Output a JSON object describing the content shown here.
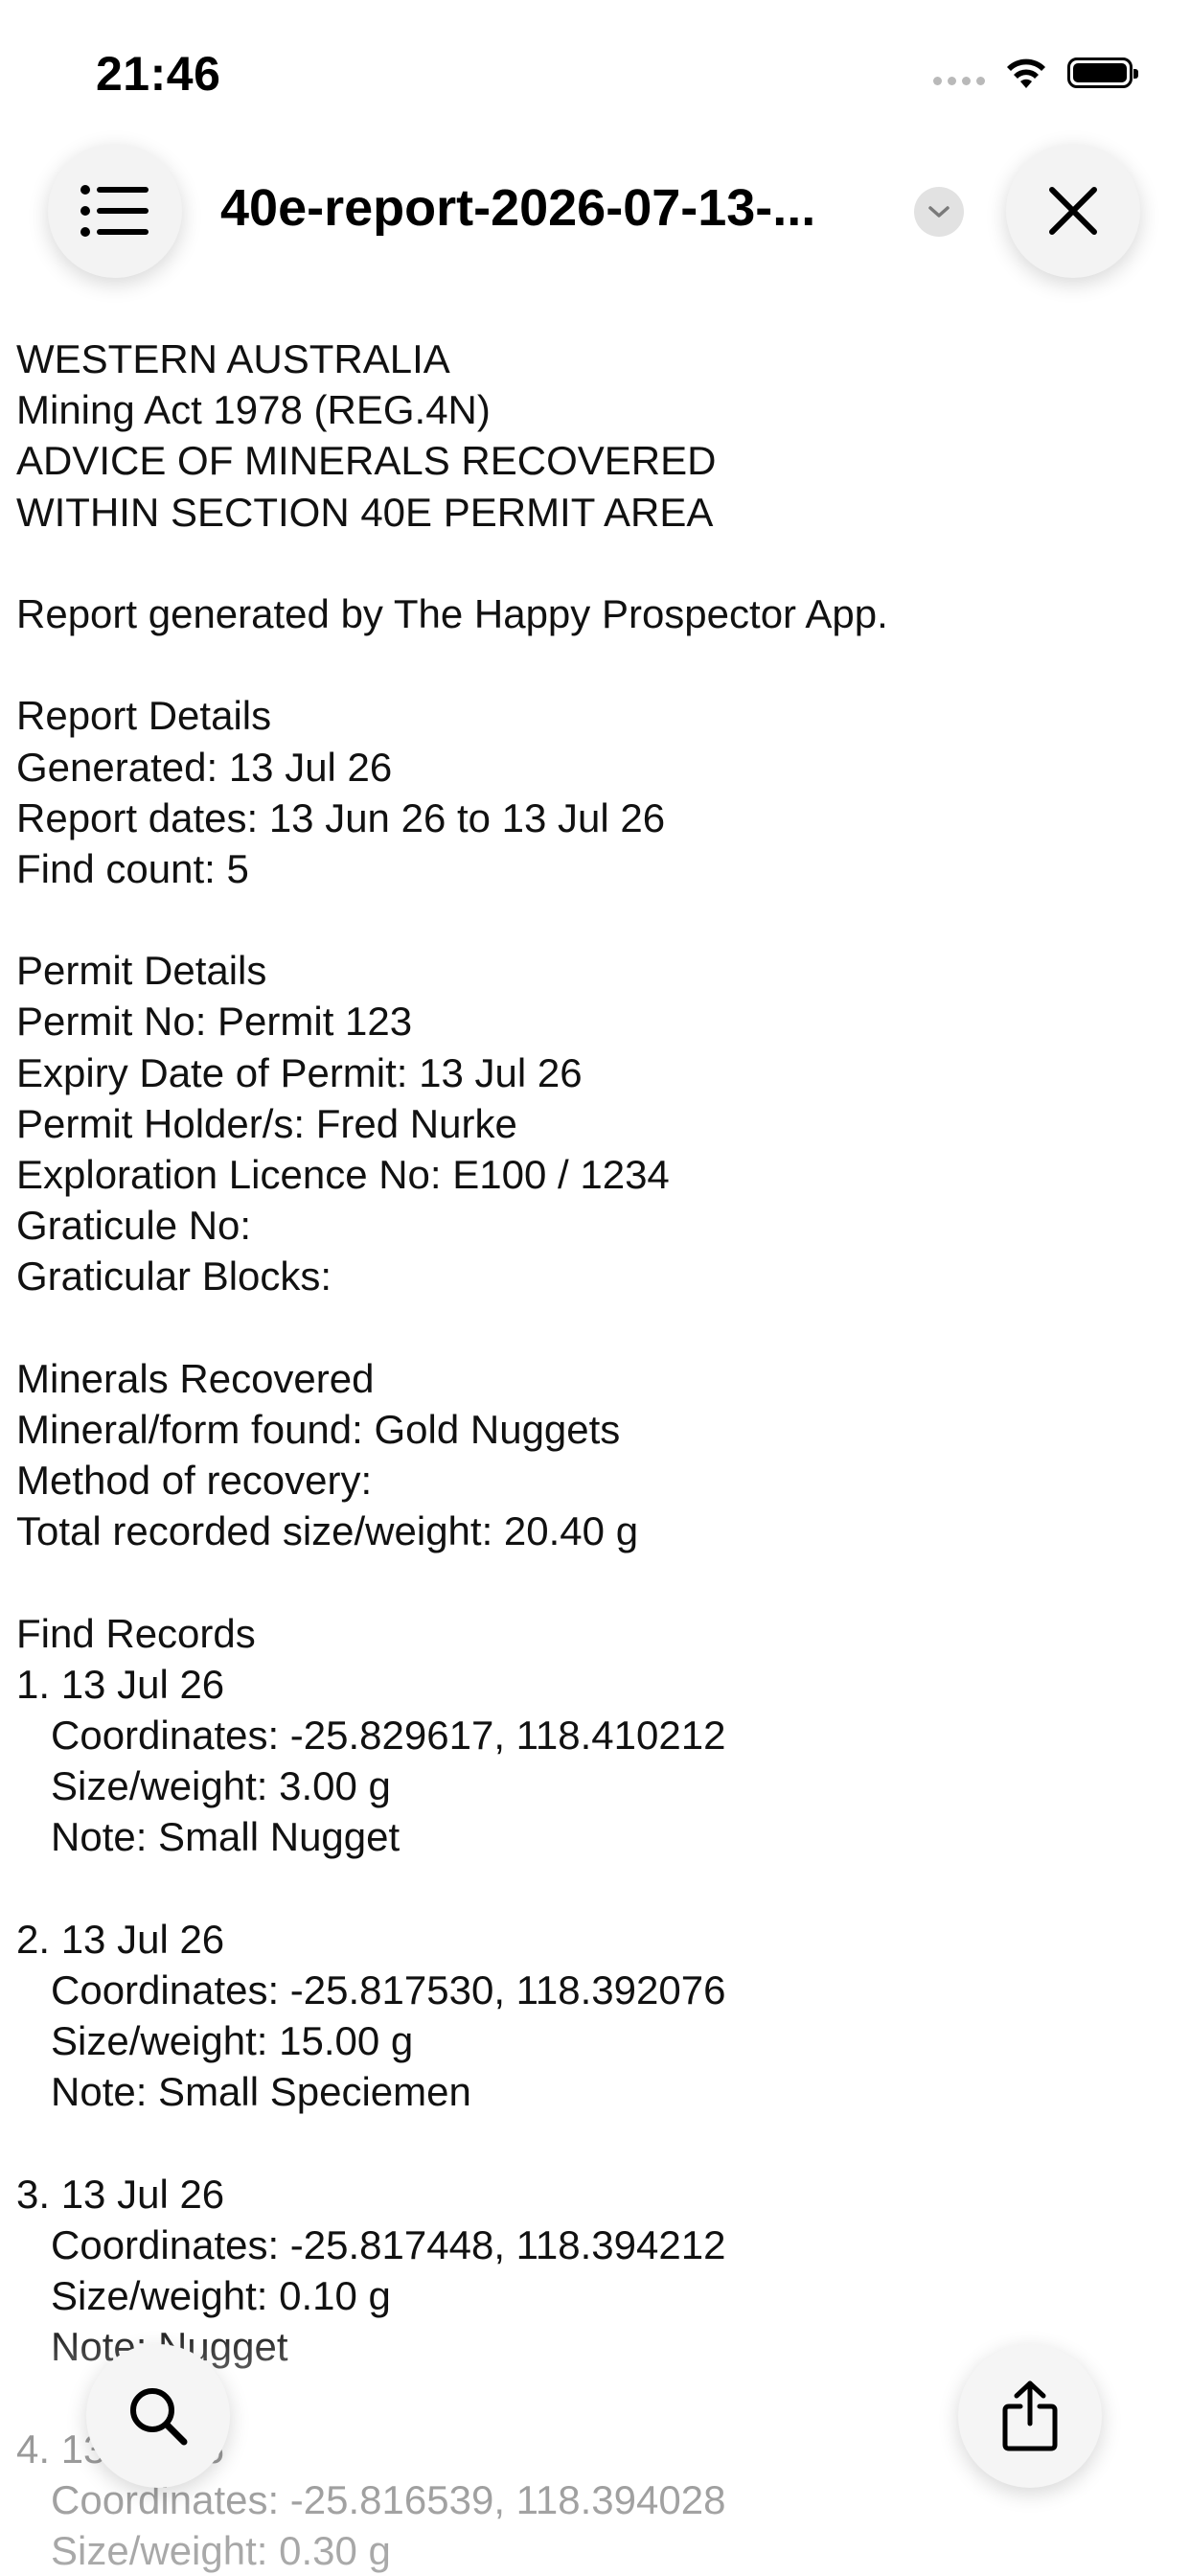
{
  "status_bar": {
    "time": "21:46"
  },
  "header": {
    "title": "40e-report-2026-07-13-...",
    "menu_icon": "list-icon",
    "chevron_icon": "chevron-down-icon",
    "close_icon": "close-icon"
  },
  "report": {
    "heading": [
      "WESTERN AUSTRALIA",
      "Mining Act 1978 (REG.4N)",
      "ADVICE OF MINERALS RECOVERED",
      "WITHIN SECTION 40E PERMIT AREA"
    ],
    "generated_by": "Report generated by The Happy Prospector App.",
    "report_details": {
      "title": "Report Details",
      "generated": "Generated: 13 Jul 26",
      "dates": "Report dates: 13 Jun 26 to 13 Jul 26",
      "find_count": "Find count: 5"
    },
    "permit_details": {
      "title": "Permit Details",
      "permit_no": "Permit No: Permit 123",
      "expiry": "Expiry Date of Permit: 13 Jul 26",
      "holder": "Permit Holder/s: Fred Nurke",
      "licence": "Exploration Licence No: E100 / 1234",
      "graticule": "Graticule No:",
      "blocks": "Graticular Blocks:"
    },
    "minerals": {
      "title": "Minerals Recovered",
      "mineral": "Mineral/form found: Gold Nuggets",
      "method": "Method of recovery:",
      "total": "Total recorded size/weight: 20.40 g"
    },
    "find_records_title": "Find Records",
    "finds": [
      {
        "header": "1. 13 Jul 26",
        "coordinates": "Coordinates: -25.829617, 118.410212",
        "size": "Size/weight: 3.00 g",
        "note": "Note: Small Nugget"
      },
      {
        "header": "2. 13 Jul 26",
        "coordinates": "Coordinates: -25.817530, 118.392076",
        "size": "Size/weight: 15.00 g",
        "note": "Note: Small Speciemen"
      },
      {
        "header": "3. 13 Jul 26",
        "coordinates": "Coordinates: -25.817448, 118.394212",
        "size": "Size/weight: 0.10 g",
        "note": "Note: Nugget"
      },
      {
        "header": "4. 13 Jul 26",
        "coordinates": "Coordinates: -25.816539, 118.394028",
        "size": "Size/weight: 0.30 g"
      }
    ]
  },
  "toolbar": {
    "search_icon": "search-icon",
    "share_icon": "share-icon"
  }
}
